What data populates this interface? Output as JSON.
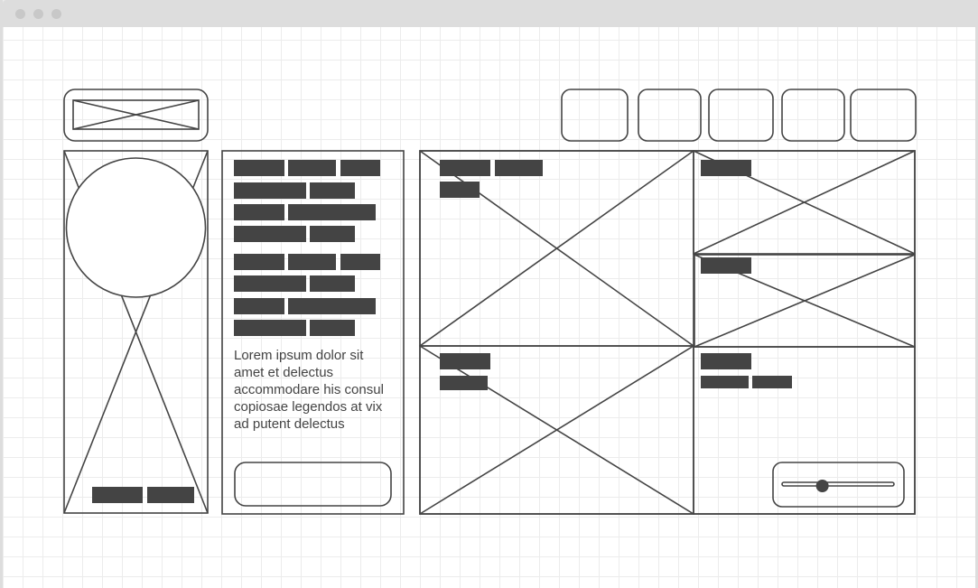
{
  "window": {
    "titlebar_buttons": [
      "close-dot",
      "minimize-dot",
      "maximize-dot"
    ]
  },
  "colors": {
    "stroke": "#444444",
    "fill_block": "#444444",
    "grid": "#ececec",
    "titlebar": "#dddddd"
  },
  "wireframe": {
    "logo": {
      "icon": "image-placeholder-icon"
    },
    "nav_buttons_count": 5,
    "text_panel": {
      "paragraph": "Lorem ipsum dolor sit amet et delectus accommodare his consul copiosae legendos at vix ad putent delectus"
    },
    "slider": {
      "value": 0.36
    }
  }
}
